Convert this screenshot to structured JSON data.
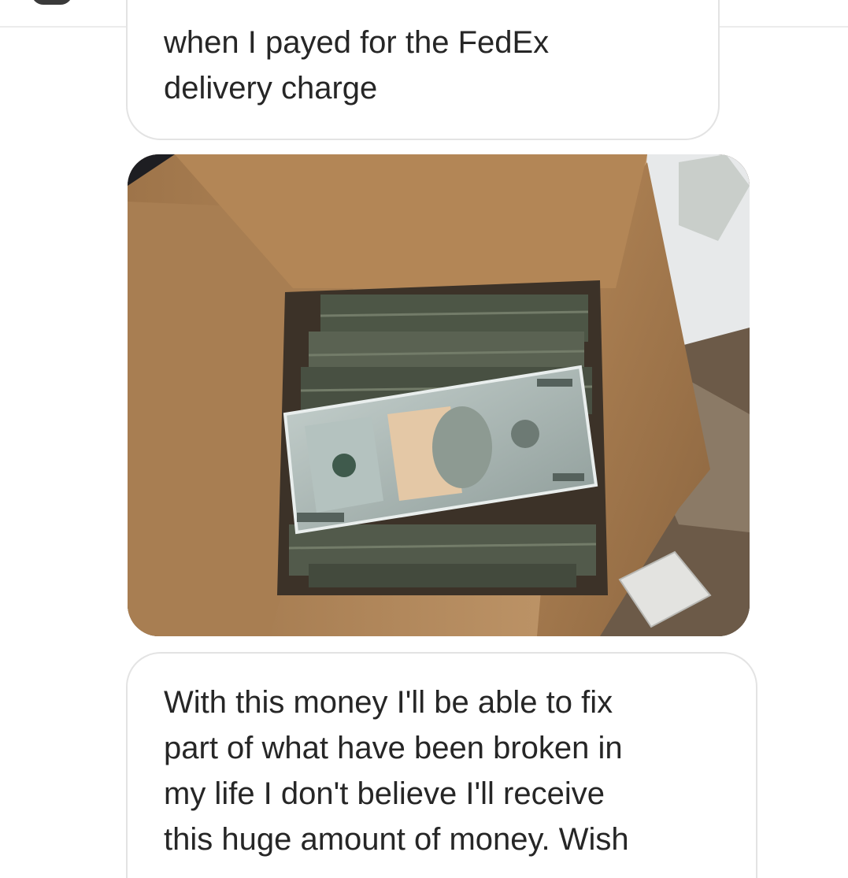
{
  "conversation": {
    "messages": [
      {
        "type": "text",
        "text": "when I payed for the FedEx\ndelivery charge"
      },
      {
        "type": "photo",
        "description": "photo-message"
      },
      {
        "type": "text",
        "text": "With this money I'll be able to fix\npart of what have been broken in\nmy life I don't believe I'll receive\nthis huge amount of money. Wish"
      }
    ]
  },
  "colors": {
    "bubble_border": "#e3e3e3",
    "text": "#262626",
    "paper_bag": "#b98d60",
    "banknote": "#a9b7b4"
  }
}
